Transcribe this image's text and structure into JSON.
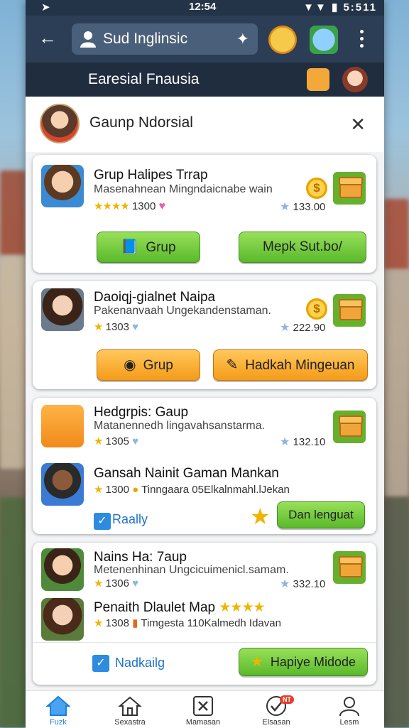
{
  "status": {
    "time": "12:54",
    "right": "▼▼ ▮ 5:511"
  },
  "header": {
    "search_text": "Sud Inglinsic"
  },
  "subheader": {
    "title": "Earesial Fnausia"
  },
  "group": {
    "name": "Gaunp Ndorsial"
  },
  "cards": [
    {
      "title": "Grup Halipes Trrap",
      "subtitle": "Masenahnean Mingndaicnabe wain",
      "meta": "1300",
      "stat": "133.00",
      "buttons": [
        "Grup",
        "Mepk Sut.bo/"
      ]
    },
    {
      "title": "Daoiqj-gialnet Naipa",
      "subtitle": "Pakenanvaah Ungekandenstaman.",
      "meta": "1303",
      "stat": "222.90",
      "buttons": [
        "Grup",
        "Hadkah Mingeuan"
      ]
    },
    {
      "rows": [
        {
          "title": "Hedgrpis: Gaup",
          "subtitle": "Matanennedh lingavahsanstarma.",
          "meta": "1305",
          "stat": "132.10"
        },
        {
          "title": "Gansah Nainit Gaman Mankan",
          "meta": "1300",
          "extra": "Tinngaara 05Elkalnmahl.lJekan"
        }
      ],
      "check_label": "Raally",
      "button": "Dan lenguat"
    },
    {
      "rows": [
        {
          "title": "Nains Ha: 7aup",
          "subtitle": "Metenenhinan Ungcicuimenicl.samam.",
          "meta": "1306",
          "stat": "332.10"
        },
        {
          "title": "Penaith Dlaulet Map",
          "meta": "1308",
          "extra": "Timgesta 110Kalmedh Idavan"
        }
      ],
      "check_label": "Nadkailg",
      "button": "Hapiye Midode"
    }
  ],
  "nav": [
    {
      "label": "Fuzk",
      "icon": "home-icon"
    },
    {
      "label": "Sexastra",
      "icon": "house-outline-icon"
    },
    {
      "label": "Mamasan",
      "icon": "close-box-icon"
    },
    {
      "label": "Elsasan",
      "icon": "check-circle-icon",
      "badge": "NT"
    },
    {
      "label": "Lesm",
      "icon": "profile-icon"
    }
  ],
  "colors": {
    "accent": "#1e7fd8",
    "button_green": "#5ab92a",
    "button_orange": "#f59b19",
    "appbar": "#2b3e55"
  }
}
